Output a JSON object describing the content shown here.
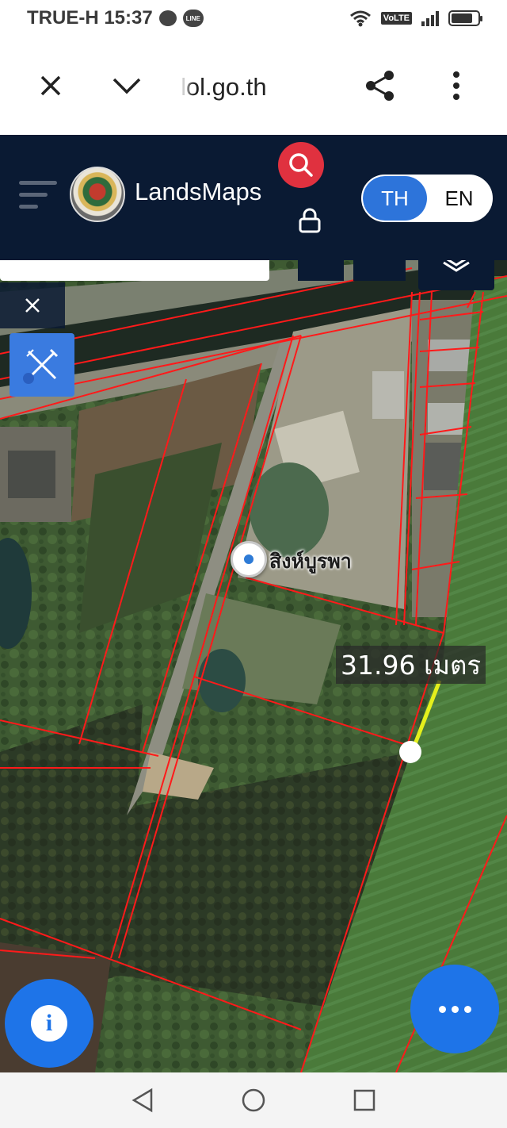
{
  "status_bar": {
    "carrier_time": "TRUE-H 15:37",
    "line_badge": "LINE",
    "volte": "VoLTE",
    "battery_level": 0.8
  },
  "browser": {
    "url": "lol.go.th",
    "icons": [
      "close-icon",
      "chevron-down-icon",
      "share-icon",
      "more-vertical-icon"
    ]
  },
  "app_header": {
    "brand": "LandsMaps",
    "languages": [
      {
        "label": "TH",
        "active": true
      },
      {
        "label": "EN",
        "active": false
      }
    ],
    "accent_color": "#e0313f",
    "header_color": "#0a1a33",
    "lang_active_color": "#2d74da"
  },
  "map": {
    "place_label": "สิงห์บูรพา",
    "measurement": "31.96 เมตร",
    "parcel_line_color": "#ff1a1a",
    "measure_line_color": "#e4f01c",
    "fab_color": "#1e74e8"
  },
  "nav_bar": {
    "icons": [
      "back-icon",
      "home-icon",
      "recents-icon"
    ]
  }
}
